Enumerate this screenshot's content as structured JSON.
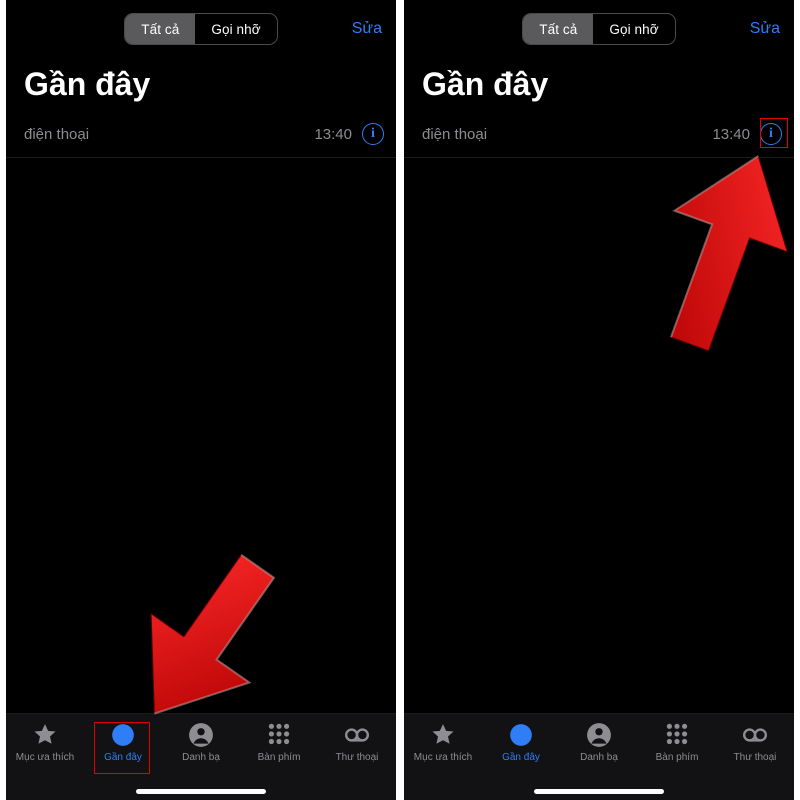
{
  "shared": {
    "segment_all": "Tất cả",
    "segment_missed": "Gọi nhỡ",
    "edit": "Sửa",
    "title": "Gần đây",
    "row_label": "điện thoại",
    "row_time": "13:40",
    "tabs": {
      "favorites": "Mục ưa thích",
      "recents": "Gần đây",
      "contacts": "Danh bạ",
      "keypad": "Bàn phím",
      "voicemail": "Thư thoại"
    }
  }
}
